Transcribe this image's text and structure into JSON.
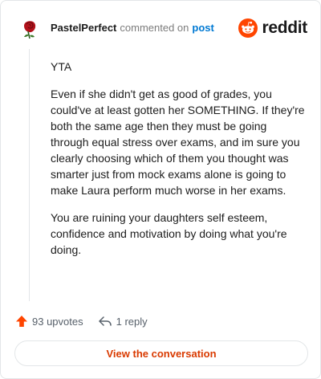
{
  "header": {
    "username": "PastelPerfect",
    "action": "commented on",
    "post_link": "post",
    "brand": "reddit",
    "avatar_icon": "rose-avatar-icon"
  },
  "comment": {
    "paragraphs": [
      "YTA",
      "Even if she didn't get as good of grades, you could've at least gotten her SOMETHING. If they're both the same age then they must be going through equal stress over exams, and im sure you clearly choosing which of them you thought was smarter just from mock exams alone is going to make Laura perform much worse in her exams.",
      "You are ruining your daughters self esteem, confidence and motivation by doing what you're doing."
    ]
  },
  "footer": {
    "upvotes": "93 upvotes",
    "replies": "1 reply",
    "upvote_icon": "upvote-arrow-icon",
    "reply_icon": "reply-arrow-icon"
  },
  "cta": {
    "label": "View the conversation"
  },
  "colors": {
    "brand_orange": "#ff4500",
    "link_blue": "#0079d3",
    "cta_text": "#d93a00",
    "border": "#e3e6e8"
  }
}
